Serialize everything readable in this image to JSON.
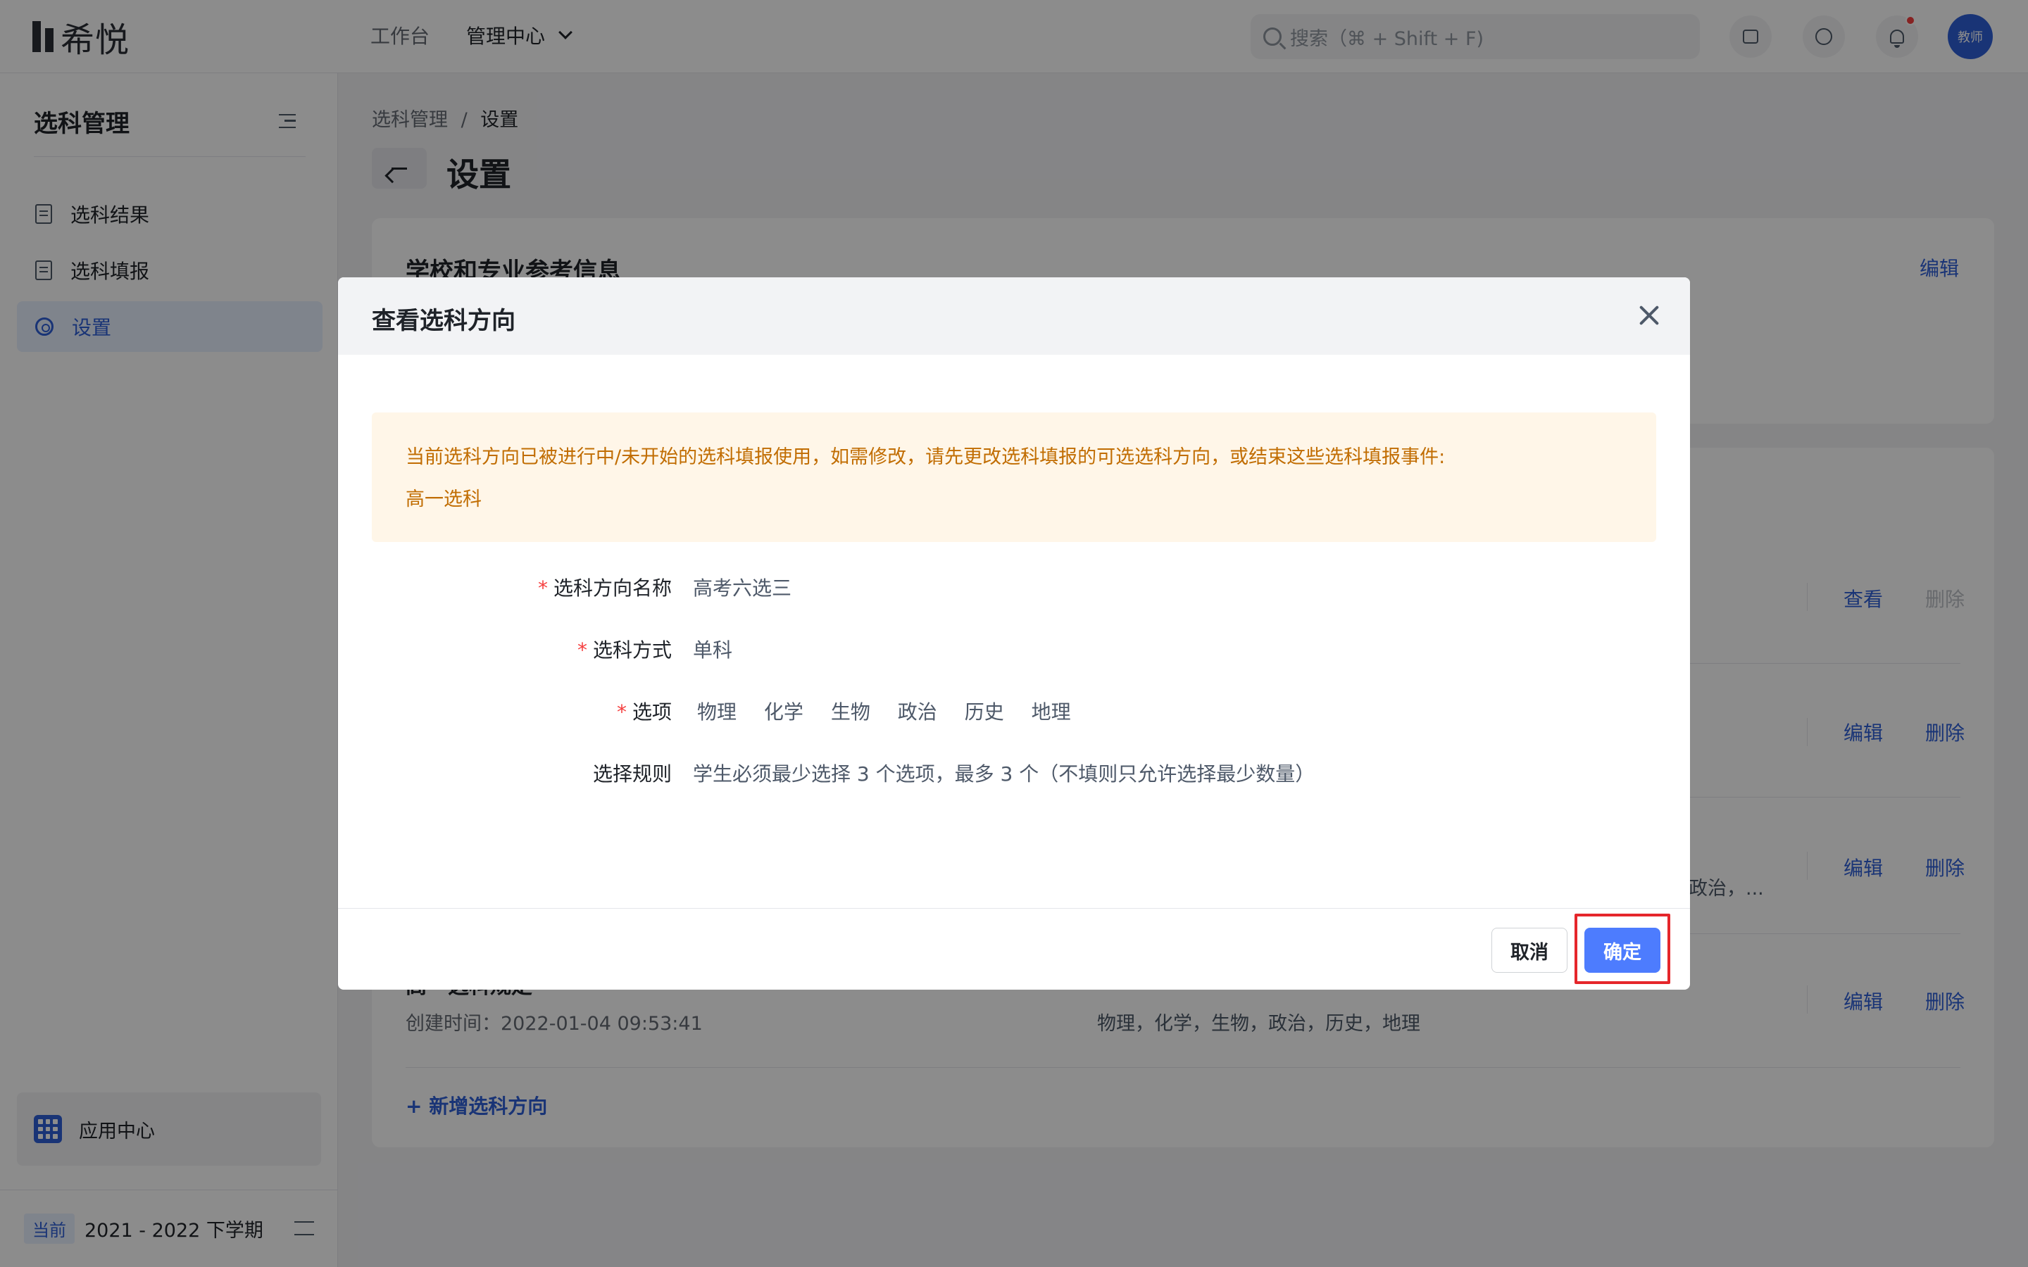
{
  "topbar": {
    "logo_text": "希悦",
    "nav": {
      "workbench": "工作台",
      "admin_center": "管理中心"
    },
    "search_placeholder": "搜索（⌘ + Shift + F)",
    "avatar_label": "教师",
    "notification_dot_color": "#f53f3f"
  },
  "sidebar": {
    "title": "选科管理",
    "items": [
      {
        "label": "选科结果",
        "icon": "document-icon"
      },
      {
        "label": "选科填报",
        "icon": "form-edit-icon"
      },
      {
        "label": "设置",
        "icon": "gear-icon",
        "active": true
      }
    ],
    "app_center": "应用中心",
    "term": {
      "tag": "当前",
      "label": "2021 - 2022 下学期"
    }
  },
  "main": {
    "breadcrumb": {
      "root": "选科管理",
      "sep": "/",
      "current": "设置"
    },
    "title": "设置",
    "card1": {
      "title": "学校和专业参考信息",
      "edit": "编辑"
    },
    "rows": [
      {
        "actions": [
          "查看",
          "删除"
        ],
        "delete_disabled": true
      },
      {
        "actions": [
          "编辑",
          "删除"
        ]
      },
      {
        "actions": [
          "编辑",
          "删除"
        ],
        "subjects_tail": "政治，..."
      },
      {
        "name": "高一选科规定",
        "actions": [
          "编辑",
          "删除"
        ],
        "created": "创建时间：2022-01-04 09:53:41",
        "subjects": "物理，化学，生物，政治，历史，地理"
      }
    ],
    "add_direction": "+ 新增选科方向"
  },
  "modal": {
    "title": "查看选科方向",
    "alert": {
      "message": "当前选科方向已被进行中/未开始的选科填报使用，如需修改，请先更改选科填报的可选选科方向，或结束这些选科填报事件:",
      "event": "高一选科"
    },
    "fields": {
      "name": {
        "label": "选科方向名称",
        "value": "高考六选三"
      },
      "mode": {
        "label": "选科方式",
        "value": "单科"
      },
      "options": {
        "label": "选项",
        "values": [
          "物理",
          "化学",
          "生物",
          "政治",
          "历史",
          "地理"
        ]
      },
      "rule": {
        "label": "选择规则",
        "value": "学生必须最少选择 3 个选项，最多 3 个（不填则只允许选择最少数量）"
      }
    },
    "cancel": "取消",
    "confirm": "确定",
    "primary_color": "#4d7cfe",
    "highlight_color": "#e5262b"
  }
}
